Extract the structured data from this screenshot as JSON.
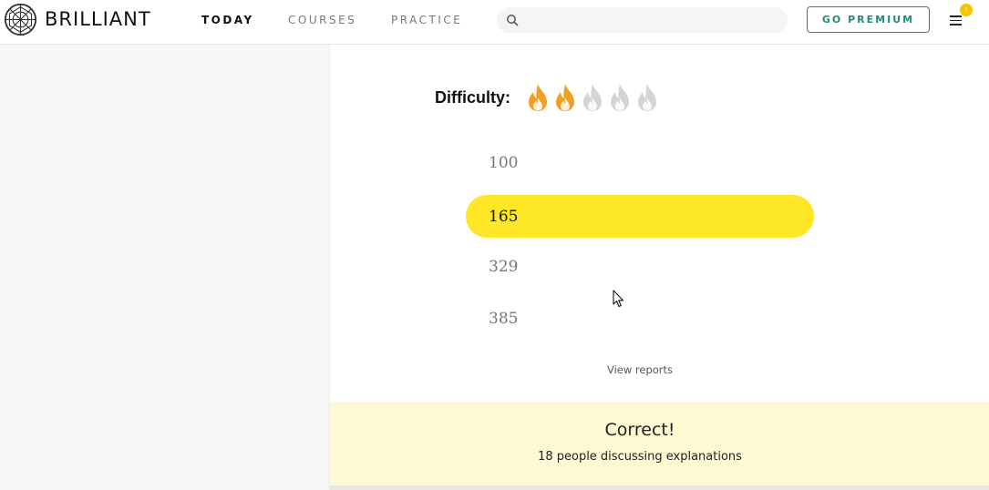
{
  "brand": {
    "name": "BRILLIANT"
  },
  "nav": {
    "items": [
      {
        "label": "TODAY",
        "active": true
      },
      {
        "label": "COURSES",
        "active": false
      },
      {
        "label": "PRACTICE",
        "active": false
      }
    ]
  },
  "search": {
    "placeholder": "",
    "value": ""
  },
  "premium_button": {
    "label": "GO PREMIUM"
  },
  "menu": {
    "badge": "!"
  },
  "difficulty": {
    "label": "Difficulty:",
    "level": 2,
    "max": 5
  },
  "options": [
    {
      "text": "100",
      "selected": false
    },
    {
      "text": "165",
      "selected": true
    },
    {
      "text": "329",
      "selected": false
    },
    {
      "text": "385",
      "selected": false
    }
  ],
  "view_reports": "View reports",
  "result": {
    "title": "Correct!",
    "subtitle": "18 people discussing explanations"
  },
  "colors": {
    "accent": "#1e8c7e",
    "selected": "#fde727",
    "flame_active": "#f0a020",
    "flame_inactive": "#d4d4d4",
    "result_bg": "#fdf9d2"
  }
}
